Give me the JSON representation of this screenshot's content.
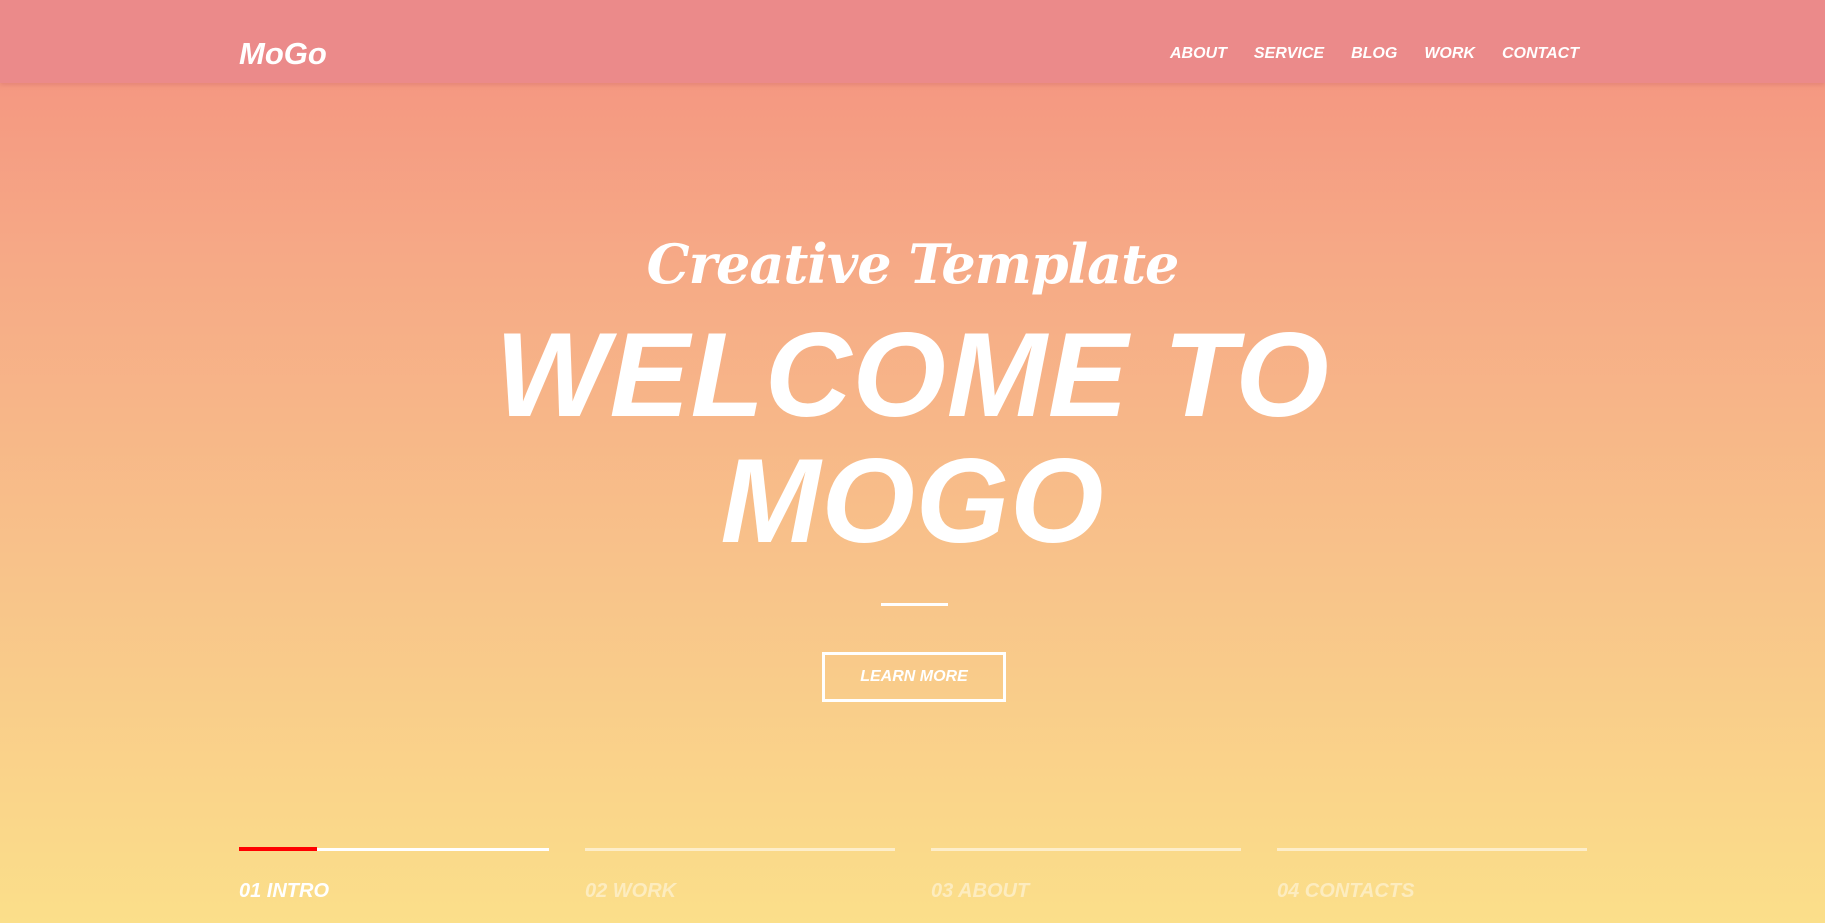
{
  "header": {
    "logo": "MoGo",
    "nav": [
      "ABOUT",
      "SERVICE",
      "BLOG",
      "WORK",
      "CONTACT"
    ]
  },
  "hero": {
    "subtitle": "Creative Template",
    "title_line1": "WELCOME TO",
    "title_line2": "MOGO",
    "button_label": "LEARN MORE"
  },
  "slider": {
    "active_index": 0,
    "active_progress": 0.25,
    "items": [
      {
        "label": "01 INTRO"
      },
      {
        "label": "02 WORK"
      },
      {
        "label": "03 ABOUT"
      },
      {
        "label": "04 CONTACTS"
      }
    ]
  },
  "colors": {
    "header_bg": "#eb8a8a",
    "gradient_top": "#f4907f",
    "gradient_bottom": "#fbdf8a",
    "progress_accent": "#ff0000",
    "text": "#ffffff"
  }
}
